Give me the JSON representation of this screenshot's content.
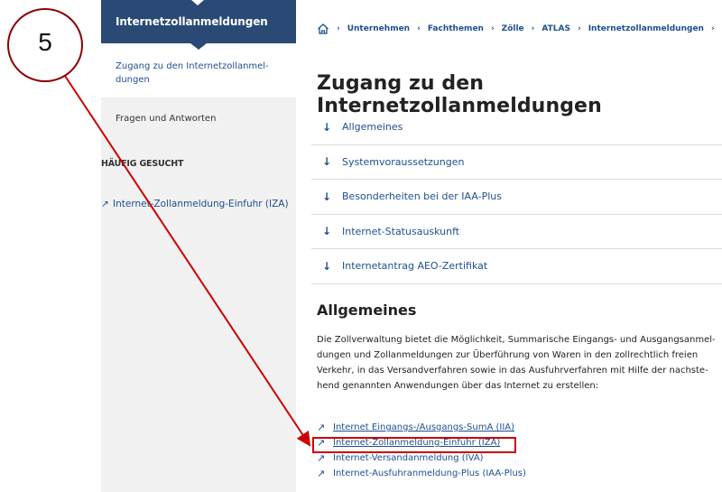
{
  "sidebar": {
    "header": "Internetzollanmeldungen",
    "active_item": "Zugang zu den Internetzollanmel-dungen",
    "item": "Fragen und Antworten",
    "section_title": "HÄUFIG GESUCHT",
    "link": "Internet-Zollanmeldung-Einfuhr (IZA)"
  },
  "breadcrumb": [
    "Unternehmen",
    "Fachthemen",
    "Zölle",
    "ATLAS",
    "Internetzollanmeldungen"
  ],
  "page_title": "Zugang zu den Internetzollanmeldungen",
  "toc": [
    "Allgemeines",
    "Systemvoraussetzungen",
    "Besonderheiten bei der IAA-Plus",
    "Internet-Statusauskunft",
    "Internetantrag AEO-Zertifikat"
  ],
  "section": {
    "title": "Allgemeines",
    "body": "Die Zollverwaltung bietet die Möglichkeit, Summarische Eingangs- und Ausgangsanmel-dungen und Zollanmeldungen zur Überführung von Waren in den zollrechtlich freien Verkehr, in das Versandverfahren sowie in das Ausfuhrverfahren mit Hilfe der nachste-hend genannten Anwendungen über das Internet zu erstellen:"
  },
  "links": [
    "Internet Eingangs-/Ausgangs-SumA (IIA)",
    "Internet-Zollanmeldung-Einfuhr (IZA)",
    "Internet-Versandanmeldung (IVA)",
    "Internet-Ausfuhranmeldung-Plus (IAA-Plus)"
  ],
  "annotation": {
    "number": "5"
  },
  "icons": {
    "home": "home-icon",
    "external": "external-link-arrow-icon",
    "down": "arrow-down-icon"
  },
  "colors": {
    "primary": "#2a4a75",
    "link": "#1d4f91",
    "annotation": "#cc0000",
    "sidebar_bg": "#f1f1f1"
  }
}
